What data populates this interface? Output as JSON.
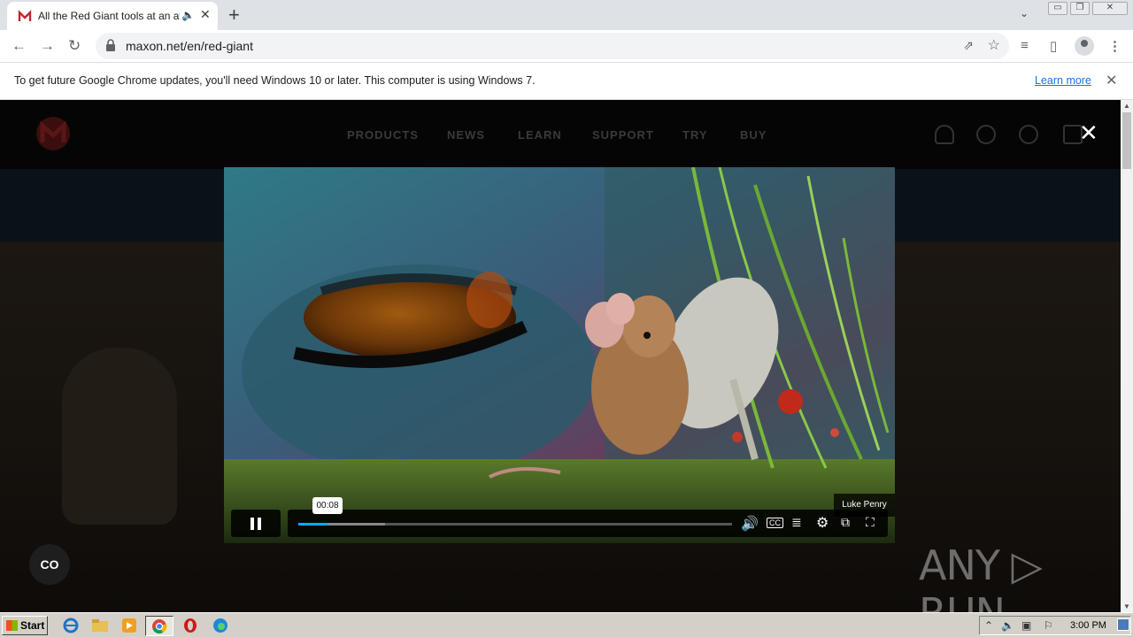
{
  "browser": {
    "tab": {
      "title": "All the Red Giant tools at an affordable price",
      "audio_icon": "speaker-icon",
      "close_glyph": "✕"
    },
    "new_tab_glyph": "+",
    "tab_search_glyph": "⌄",
    "window_controls": {
      "minimize": "▭",
      "restore": "❐",
      "close": "✕"
    },
    "nav": {
      "back": "←",
      "forward": "→",
      "reload": "↻"
    },
    "address": {
      "url": "maxon.net/en/red-giant",
      "share_glyph": "⇗",
      "star_glyph": "☆"
    },
    "toolbar_icons": {
      "media": "≡",
      "sidepanel": "▯",
      "menu": "⋮"
    },
    "infobar": {
      "message": "To get future Google Chrome updates, you'll need Windows 10 or later. This computer is using Windows 7.",
      "link": "Learn more",
      "close_glyph": "✕"
    }
  },
  "site": {
    "nav": [
      "PRODUCTS",
      "NEWS",
      "LEARN",
      "SUPPORT",
      "TRY",
      "BUY"
    ],
    "modal_close_glyph": "✕",
    "cc_button": "CO",
    "brand_color": "#b01e1e"
  },
  "video": {
    "credit": "Luke Penry",
    "time_tooltip": "00:08",
    "progress_fraction": 0.07,
    "loaded_fraction": 0.2,
    "controls": [
      "pause-icon",
      "volume-icon",
      "captions-icon",
      "transcript-icon",
      "settings-icon",
      "pip-icon",
      "fullscreen-icon"
    ],
    "accent_color": "#00adef"
  },
  "watermark": "ANY ▷ RUN",
  "taskbar": {
    "start_label": "Start",
    "apps": [
      "ie-icon",
      "explorer-icon",
      "media-player-icon",
      "chrome-icon",
      "opera-icon",
      "edge-icon"
    ],
    "clock": "3:00 PM"
  }
}
